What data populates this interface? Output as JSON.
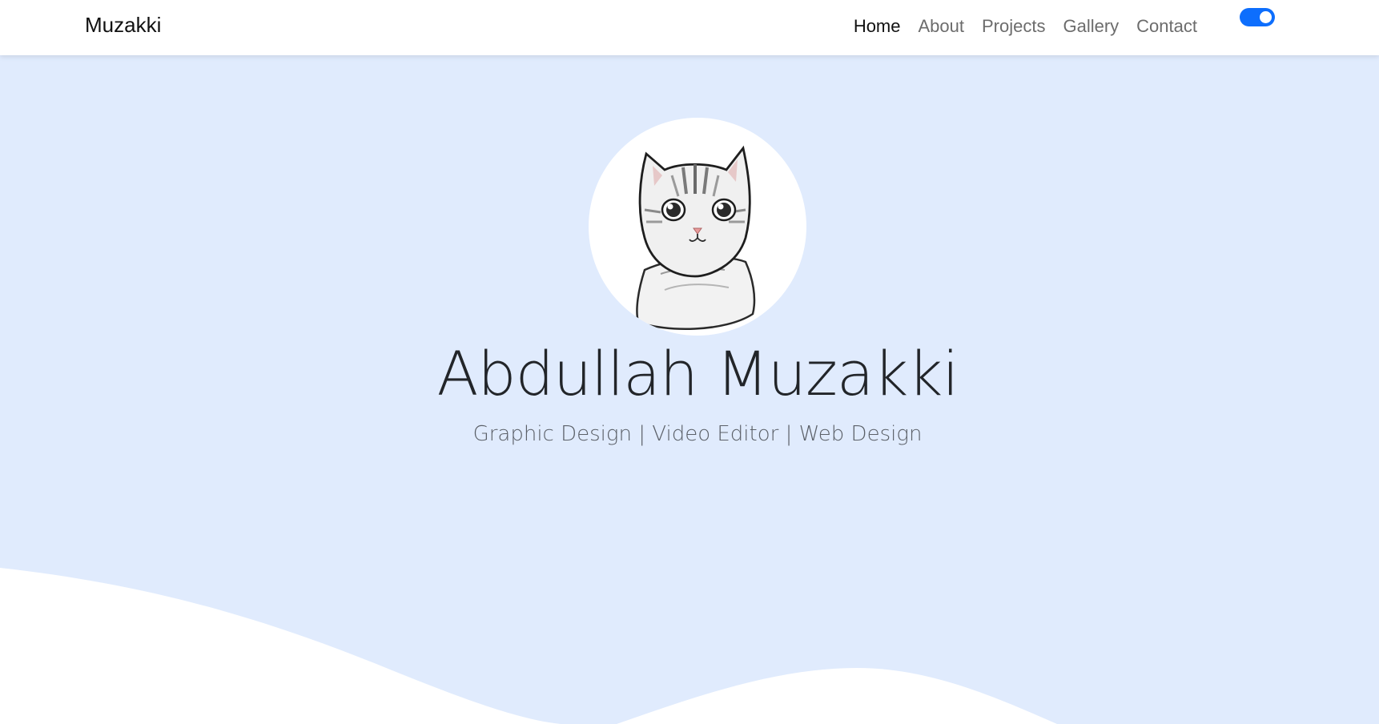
{
  "navbar": {
    "brand": "Muzakki",
    "links": [
      {
        "label": "Home",
        "active": true
      },
      {
        "label": "About",
        "active": false
      },
      {
        "label": "Projects",
        "active": false
      },
      {
        "label": "Gallery",
        "active": false
      },
      {
        "label": "Contact",
        "active": false
      }
    ],
    "theme_toggle": {
      "on": true,
      "color": "#0d6efd"
    }
  },
  "hero": {
    "name": "Abdullah Muzakki",
    "tagline": "Graphic Design | Video Editor | Web Design",
    "avatar_icon": "cat-illustration",
    "background_color": "#e0ebfd"
  }
}
